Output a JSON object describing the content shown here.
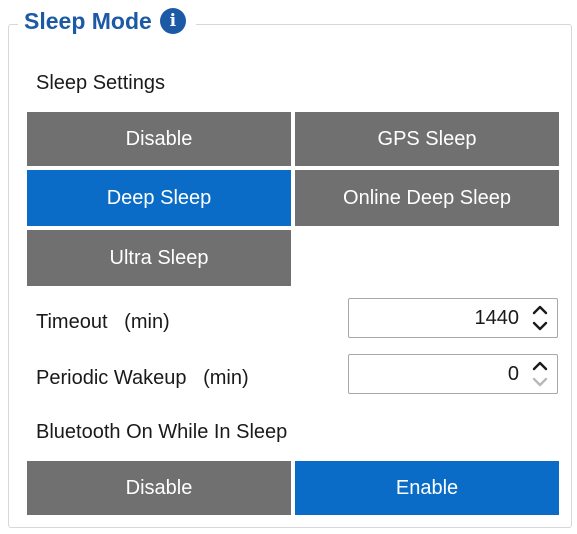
{
  "group": {
    "title": "Sleep Mode"
  },
  "sleep_settings": {
    "label": "Sleep Settings",
    "options": [
      "Disable",
      "GPS Sleep",
      "Deep Sleep",
      "Online Deep Sleep",
      "Ultra Sleep"
    ],
    "selected": "Deep Sleep"
  },
  "timeout": {
    "label": "Timeout   (min)",
    "value": "1440"
  },
  "periodic_wakeup": {
    "label": "Periodic Wakeup   (min)",
    "value": "0"
  },
  "bluetooth": {
    "label": "Bluetooth On While In Sleep",
    "options": [
      "Disable",
      "Enable"
    ],
    "selected": "Enable"
  },
  "colors": {
    "accent": "#0a6cc6",
    "button_gray": "#707070",
    "title_blue": "#1c5aa6"
  },
  "icons": {
    "info": "info-icon",
    "spin_up": "chevron-up-icon",
    "spin_down": "chevron-down-icon"
  }
}
